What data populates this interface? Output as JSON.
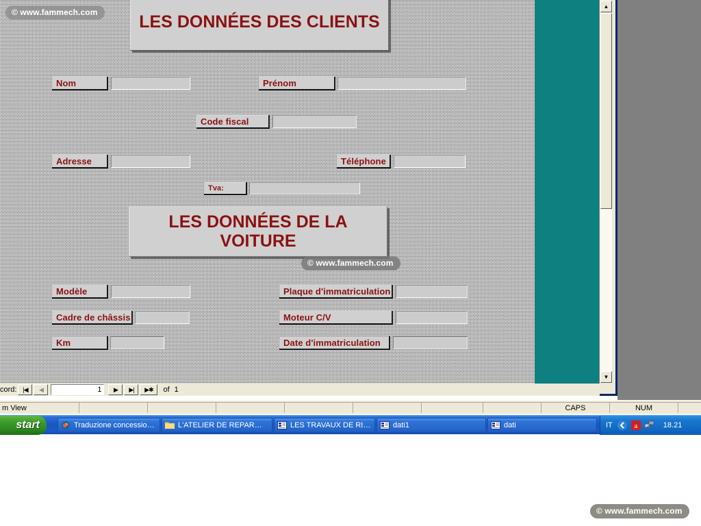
{
  "watermarks": {
    "top_left": "© www.fammech.com",
    "middle": "© www.fammech.com",
    "bottom_right": "© www.fammech.com"
  },
  "form": {
    "banners": {
      "clients": "LES DONNÉES DES CLIENTS",
      "voiture": "LES DONNÉES DE LA VOITURE"
    },
    "client_fields": [
      {
        "label": "Nom",
        "value": ""
      },
      {
        "label": "Prénom",
        "value": ""
      },
      {
        "label": "Code fiscal",
        "value": ""
      },
      {
        "label": "Adresse",
        "value": ""
      },
      {
        "label": "Téléphone",
        "value": ""
      },
      {
        "label": "Tva:",
        "value": ""
      }
    ],
    "car_fields": [
      {
        "label": "Modèle",
        "value": ""
      },
      {
        "label": "Plaque d'immatriculation",
        "value": ""
      },
      {
        "label": "Cadre de châssis",
        "value": ""
      },
      {
        "label": "Moteur C/V",
        "value": ""
      },
      {
        "label": "Km",
        "value": ""
      },
      {
        "label": "Date d'immatriculation",
        "value": ""
      }
    ]
  },
  "record_navigator": {
    "label": "cord:",
    "first_icon": "|◀",
    "prev_icon": "◀",
    "current": "1",
    "next_icon": "▶",
    "last_icon": "▶|",
    "new_icon": "▶✱",
    "of_label": "of",
    "total": "1"
  },
  "scrollbar": {
    "up_icon": "▲",
    "down_icon": "▼"
  },
  "status_bar": {
    "view": "m View",
    "caps": "CAPS",
    "num": "NUM"
  },
  "taskbar": {
    "start_label": "start",
    "buttons": [
      {
        "label": "Traduzione concessio…",
        "icon": "firefox-icon"
      },
      {
        "label": "L'ATELIER DE REPAR…",
        "icon": "folder-icon"
      },
      {
        "label": "LES  TRAVAUX DE RI…",
        "icon": "access-icon"
      },
      {
        "label": "dati1",
        "icon": "access-icon"
      },
      {
        "label": "dati",
        "icon": "access-icon"
      }
    ],
    "tray": {
      "language": "IT",
      "clock": "18.21"
    }
  },
  "colors": {
    "heading_red": "#8b1111",
    "form_teal": "#0e8080",
    "window_border": "#0a246a",
    "taskbar_blue": "#1b56c0",
    "start_green": "#3f9e2e"
  }
}
